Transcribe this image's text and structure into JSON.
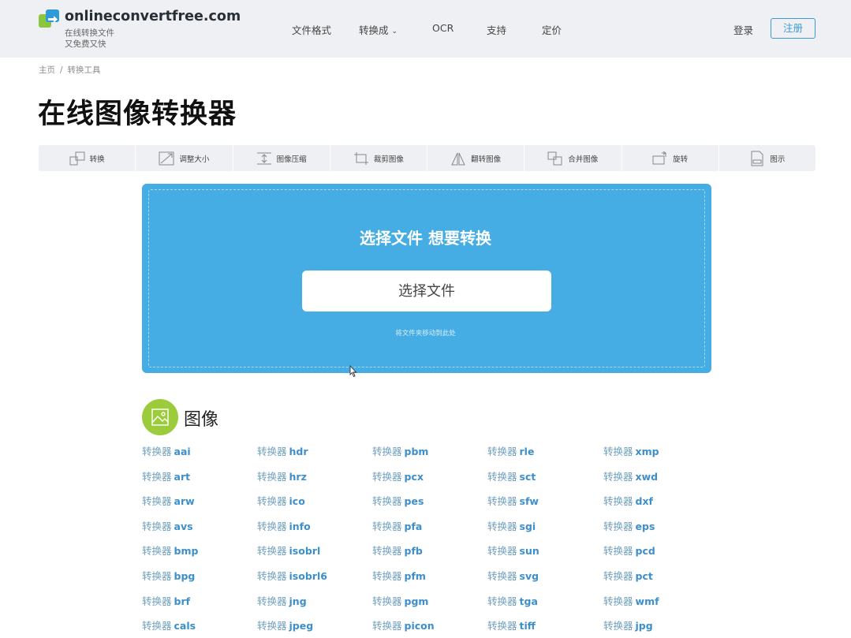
{
  "header": {
    "brand": "onlineconvertfree.com",
    "tagline_1": "在线转换文件",
    "tagline_2": "又免费又快",
    "nav": [
      "文件格式",
      "转换成",
      "OCR",
      "支持",
      "定价"
    ],
    "login": "登录",
    "register": "注册"
  },
  "breadcrumb": {
    "home": "主页",
    "sep": "/",
    "current": "转换工具"
  },
  "page_title": "在线图像转换器",
  "tools": [
    {
      "label": "转换",
      "icon": "convert-icon"
    },
    {
      "label": "调整大小",
      "icon": "resize-icon"
    },
    {
      "label": "图像压缩",
      "icon": "compress-icon"
    },
    {
      "label": "裁剪图像",
      "icon": "crop-icon"
    },
    {
      "label": "翻转图像",
      "icon": "flip-icon"
    },
    {
      "label": "合并图像",
      "icon": "merge-icon"
    },
    {
      "label": "旋转",
      "icon": "rotate-icon"
    },
    {
      "label": "图示",
      "icon": "diagram-icon"
    }
  ],
  "upload": {
    "title": "选择文件 想要转换",
    "button": "选择文件",
    "hint": "将文件夹移动到此处"
  },
  "category": {
    "title": "图像",
    "prefix": "转换器",
    "formats": [
      [
        "aai",
        "art",
        "arw",
        "avs",
        "bmp",
        "bpg",
        "brf",
        "cals"
      ],
      [
        "hdr",
        "hrz",
        "ico",
        "info",
        "isobrl",
        "isobrl6",
        "jng",
        "jpeg"
      ],
      [
        "pbm",
        "pcx",
        "pes",
        "pfa",
        "pfb",
        "pfm",
        "pgm",
        "picon"
      ],
      [
        "rle",
        "sct",
        "sfw",
        "sgi",
        "sun",
        "svg",
        "tga",
        "tiff"
      ],
      [
        "xmp",
        "xwd",
        "dxf",
        "eps",
        "pcd",
        "pct",
        "wmf",
        "jpg"
      ]
    ]
  },
  "colors": {
    "accent": "#45ade3",
    "link": "#3d8fcb",
    "category_icon": "#9ccb3b",
    "header_bg": "#eef0f3"
  }
}
